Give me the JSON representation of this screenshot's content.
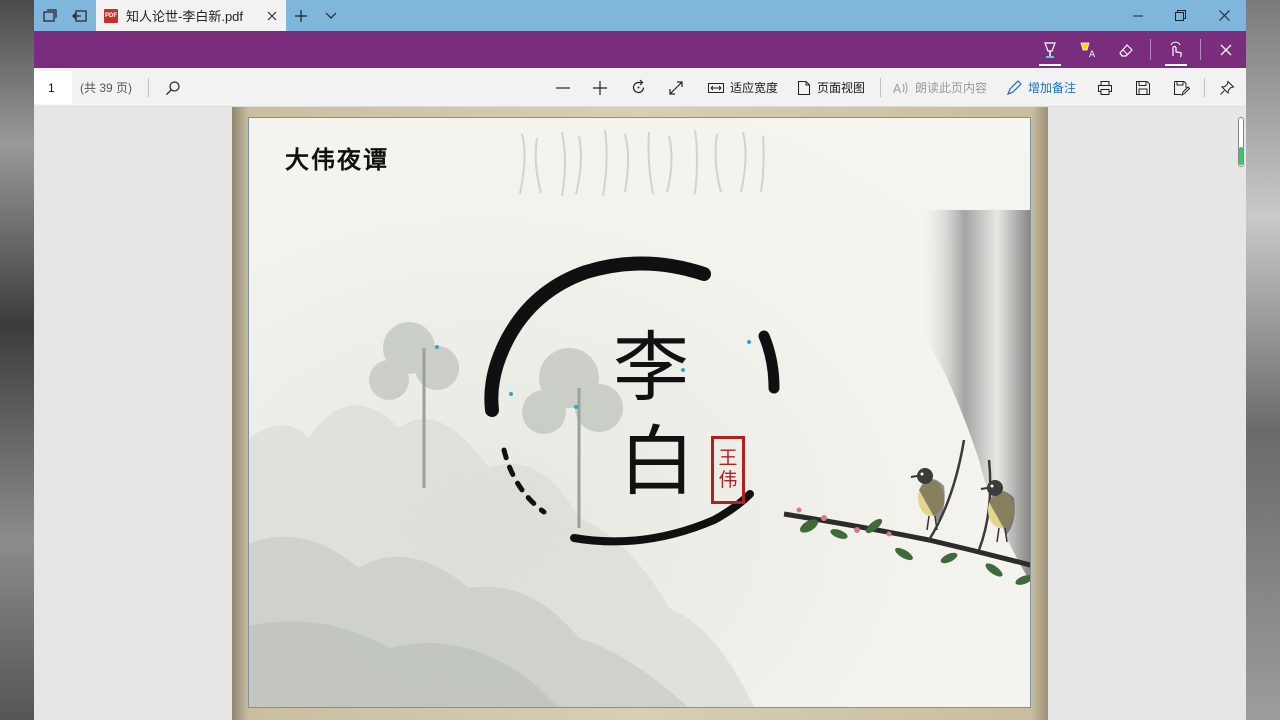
{
  "tab": {
    "title": "知人论世-李白新.pdf"
  },
  "pdf_toolbar": {
    "page_number": "1",
    "page_total": "(共 39 页)",
    "fit_width_label": "适应宽度",
    "page_view_label": "页面视图",
    "read_aloud_label": "朗读此页内容",
    "add_notes_label": "增加备注"
  },
  "slide": {
    "header": "大伟夜谭",
    "title_char_1": "李",
    "title_char_2": "白",
    "seal_char_1": "王",
    "seal_char_2": "伟"
  },
  "colors": {
    "ink_toolbar": "#7b2d7d",
    "title_bar": "#7fb6dc",
    "accent_blue": "#1f6fbf",
    "seal_red": "#b51e1e"
  }
}
